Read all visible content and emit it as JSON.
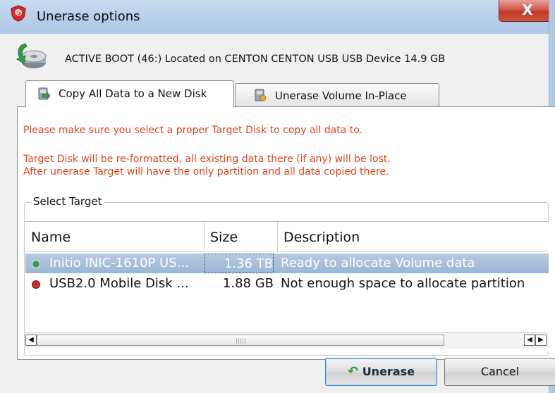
{
  "window": {
    "title": "Unerase options",
    "close_label": "X"
  },
  "device": {
    "text": "ACTIVE BOOT (46:) Located on CENTON CENTON USB USB Device 14.9 GB"
  },
  "tabs": [
    {
      "label": "Copy All Data to a New Disk",
      "active": true
    },
    {
      "label": "Unerase Volume In-Place",
      "active": false
    }
  ],
  "messages": {
    "line1": "Please make sure you select a proper Target Disk to copy all data to.",
    "line2": "Target Disk will be re-formatted, all existing data there (if any) will be lost.",
    "line3": "After unerase Target will have the only partition and all data copied there."
  },
  "select_target": {
    "label": "Select Target",
    "columns": [
      "Name",
      "Size",
      "Description"
    ],
    "rows": [
      {
        "name": "Initio INIC-1610P US...",
        "size": "1.36 TB",
        "description": "Ready to allocate Volume data",
        "status": "green",
        "selected": true
      },
      {
        "name": "USB2.0 Mobile Disk ...",
        "size": "1.88 GB",
        "description": "Not enough space to allocate partition",
        "status": "red",
        "selected": false
      }
    ]
  },
  "buttons": {
    "unerase": "Unerase",
    "cancel": "Cancel"
  },
  "colors": {
    "warning": "#e0431c",
    "selection": "#a9bfdc",
    "green_dot": "#3c9a55",
    "red_dot": "#c9302c"
  }
}
